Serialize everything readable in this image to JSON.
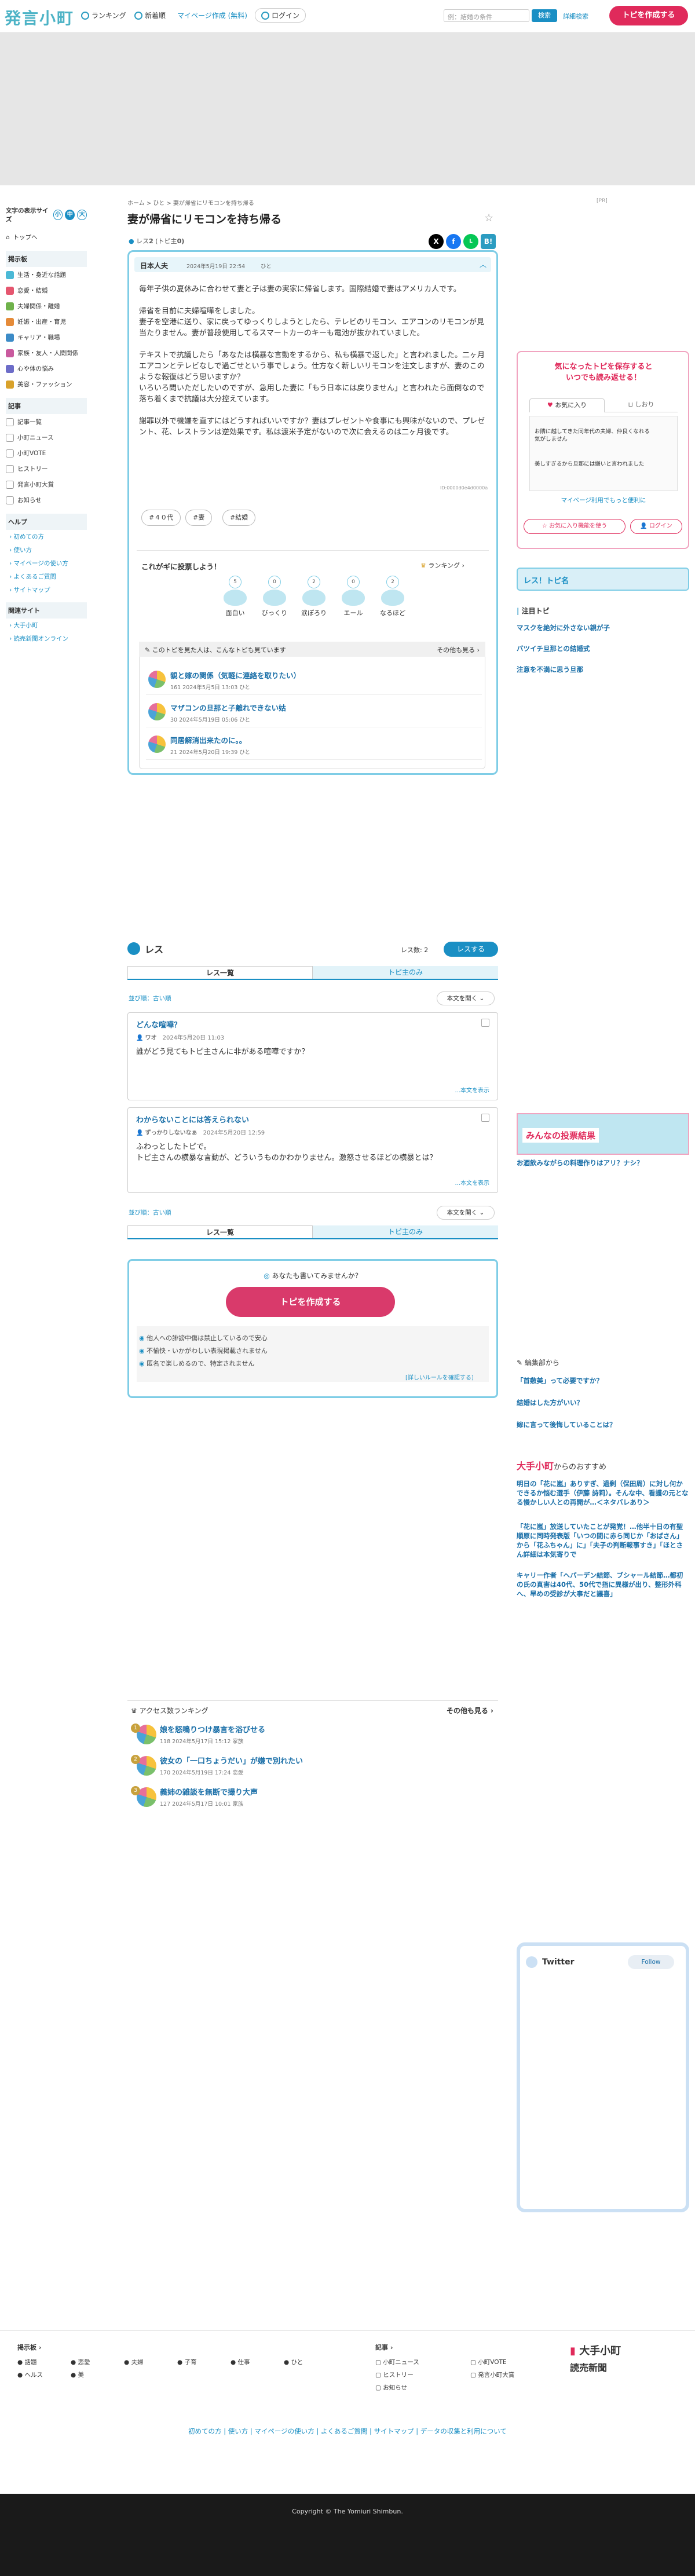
{
  "header": {
    "logo": "発言小町",
    "nav": [
      "ランキング",
      "新着順",
      "マイページ作成 (無料)",
      "ログイン"
    ],
    "search_placeholder": "例：結婚の条件",
    "search_button": "検索",
    "detail_search": "詳細検索",
    "create_button": "トピを作成する"
  },
  "left_sidebar": {
    "font_size_label": "文字の表示サイズ",
    "font_sizes": [
      "小",
      "中",
      "大"
    ],
    "top_link": "トップへ",
    "genre_title": "掲示板",
    "genres": [
      {
        "label": "生活・身近な話題",
        "color": "#4bb9d6"
      },
      {
        "label": "恋愛・結婚",
        "color": "#e5566f"
      },
      {
        "label": "夫婦関係・離婚",
        "color": "#6fb24b"
      },
      {
        "label": "妊娠・出産・育児",
        "color": "#e58b39"
      },
      {
        "label": "キャリア・職場",
        "color": "#3c8bc7"
      },
      {
        "label": "家族・友人・人間関係",
        "color": "#c95a9e"
      },
      {
        "label": "心や体の悩み",
        "color": "#6c6cc8"
      },
      {
        "label": "美容・ファッション",
        "color": "#d9a22b"
      }
    ],
    "article_title": "記事",
    "articles": [
      "記事一覧",
      "小町ニュース",
      "小町VOTE",
      "ヒストリー",
      "発言小町大賞",
      "お知らせ"
    ],
    "help_title": "ヘルプ",
    "help": [
      "初めての方",
      "使い方",
      "マイページの使い方",
      "よくあるご質問",
      "サイトマップ"
    ],
    "related_title": "関連サイト",
    "related": [
      "大手小町",
      "読売新聞オンライン"
    ]
  },
  "topic": {
    "breadcrumb": "ホーム > ひと > 妻が帰省にリモコンを持ち帰る",
    "pr": "[PR]",
    "title": "妻が帰省にリモコンを持ち帰る",
    "res_count_label": "レス",
    "res_count": "2",
    "topic_count_label": "(トピ主",
    "topic_count": "0)",
    "author": "日本人夫",
    "date": "2024年5月19日 22:54",
    "category": "ひと",
    "body": "毎年子供の夏休みに合わせて妻と子は妻の実家に帰省します。国際結婚で妻はアメリカ人です。\n\n帰省を目前に夫婦喧嘩をしました。\n妻子を空港に送り、家に戻ってゆっくりしようとしたら、テレビのリモコン、エアコンのリモコンが見当たりません。妻が普段使用してるスマートカーのキーも電池が抜かれていました。\n\nテキストで抗議したら「あなたは横暴な言動をするから、私も横暴で返した」と言われました。二ヶ月エアコンとテレビなしで過ごせという事でしょう。仕方なく新しいリモコンを注文しますが、妻のこのような報復はどう思いますか？\nいろいろ問いただしたいのですが、急用した妻に「もう日本には戻りません」と言われたら面倒なので落ち着くまで抗議は大分控えています。\n\n謝罪以外で機嫌を直すにはどうすればいいですか？妻はプレゼントや食事にも興味がないので、プレゼント、花、レストランは逆効果です。私は渡米予定がないので次に会えるのは二ヶ月後です。",
    "id": "ID:0000d0e4d0000a",
    "tags": [
      "#４０代",
      "#妻",
      "#結婚"
    ],
    "vote_title": "これがギに投票しよう！",
    "ranking_link": "ランキング",
    "votes": [
      {
        "label": "面白い",
        "count": "5"
      },
      {
        "label": "びっくり",
        "count": "0"
      },
      {
        "label": "涙ぽろり",
        "count": "2"
      },
      {
        "label": "エール",
        "count": "0"
      },
      {
        "label": "なるほど",
        "count": "2"
      }
    ],
    "related_header": "このトピを見た人は、こんなトピも見ています",
    "related_more": "その他も見る",
    "related": [
      {
        "title": "親と嫁の関係（気軽に連絡を取りたい）",
        "meta": "161  2024年5月5日 13:03  ひと"
      },
      {
        "title": "マザコンの旦那と子離れできない姑",
        "meta": "30  2024年5月19日 05:06  ひと"
      },
      {
        "title": "同居解消出来たのに。。",
        "meta": "21  2024年5月20日 19:39  ひと"
      }
    ]
  },
  "responses": {
    "title": "レス",
    "count_label": "レス数: 2",
    "reply_button": "レスする",
    "tabs": [
      "レス一覧",
      "トピ主のみ"
    ],
    "sort_left": "古い順",
    "sort_mode": "並び順：",
    "sort_right": "本文を開く",
    "items": [
      {
        "title": "どんな喧嘩？",
        "author": "ワオ",
        "date": "2024年5月20日 11:03",
        "body": "誰がどう見てもトピ主さんに非がある喧嘩ですか？",
        "more": "...本文を表示"
      },
      {
        "title": "わからないことには答えられない",
        "author": "ずっかりしないなぁ",
        "date": "2024年5月20日 12:59",
        "body": "ふわっとしたトピで。\nトピ主さんの横暴な言動が、どういうものかわかりません。激怒させるほどの横暴とは？",
        "more": "...本文を表示"
      }
    ],
    "cta_question": "あなたも書いてみませんか？",
    "cta_button": "トピを作成する",
    "cta_points": [
      "他人への誹謗中傷は禁止しているので安心",
      "不愉快・いかがわしい表現掲載されません",
      "匿名で楽しめるので、特定されません"
    ],
    "cta_rule": "[詳しいルールを確認する]"
  },
  "ranking": {
    "title": "アクセス数ランキング",
    "more": "その他も見る",
    "items": [
      {
        "rank": "1",
        "title": "娘を怒鳴りつけ暴言を浴びせる",
        "meta": "118  2024年5月17日 15:12  家族"
      },
      {
        "rank": "2",
        "title": "彼女の「一口ちょうだい」が嫌で別れたい",
        "meta": "170  2024年5月19日 17:24  恋愛"
      },
      {
        "rank": "3",
        "title": "義姉の雑談を無断で撮り大声",
        "meta": "127  2024年5月17日 10:01  家族"
      }
    ]
  },
  "right_sidebar": {
    "ad_title": "気になったトピを保存すると\nいつでも読み返せる！",
    "ad_tabs": [
      "お気に入り",
      "しおり"
    ],
    "ad_items": [
      "お隣に越してきた同年代の夫婦、仲良くなれる気がしません",
      "美しすぎるから旦那には嫌いと言われました"
    ],
    "ad_note": "マイページ利用でもっと便利に",
    "ad_buttons": [
      "お気に入り機能を使う",
      "ログイン"
    ],
    "mini_banner": "レス！トピ名",
    "notice_title": "注目トピ",
    "notice_links": [
      "マスクを絶対に外さない親が子",
      "バツイチ旦那との結婚式",
      "注意を不満に思う旦那"
    ],
    "vote_result_banner": "みんなの投票結果",
    "vote_result_link": "お酒飲みながらの料理作りはアリ？ナシ？",
    "editor_title": "編集部から",
    "editor_links": [
      "「首敷美」って必要ですか？",
      "結婚はした方がいい？",
      "嫁に言って後悔していることは？"
    ],
    "brand_title": "大手小町",
    "brand_suffix": "からのおすすめ",
    "brand_links": [
      "明日の「花に嵐」ありすぎ、過剰（保田周）に対し何かできるか悩む選手（伊藤 詩莉）。そんな中、看護の元となる慢かしい人との再開が…＜ネタバレあり＞",
      "「花に嵐」放送していたことが発覚！…他半十日の有聖順原に同時発表版「いつの間に赤ら同じか「おばさん」から「花ふちゃん」に」「夫子の判断報事すき」「ほとさん詳細は本気寄りで",
      "キャリー作者「ヘパーデン結節、ブシャール結節…都初の氏の真害は40代、50代で指に異様が出り、整形外科へ、早めの受診が大事だと議喜」"
    ],
    "twitter_title": "Twitter",
    "twitter_follow": "Follow"
  },
  "footer": {
    "genre_title": "掲示板",
    "genres": [
      "話題",
      "恋愛",
      "夫婦",
      "子育",
      "仕事",
      "ひと",
      "ヘルス",
      "美"
    ],
    "article_title": "記事",
    "articles": [
      "小町ニュース",
      "小町VOTE",
      "ヒストリー",
      "発言小町大賞",
      "お知らせ"
    ],
    "brand1": "大手小町",
    "brand2": "読売新聞",
    "links": "初めての方 | 使い方 | マイページの使い方 | よくあるご質問 | サイトマップ | データの収集と利用について",
    "copyright": "Copyright © The Yomiuri Shimbun."
  }
}
